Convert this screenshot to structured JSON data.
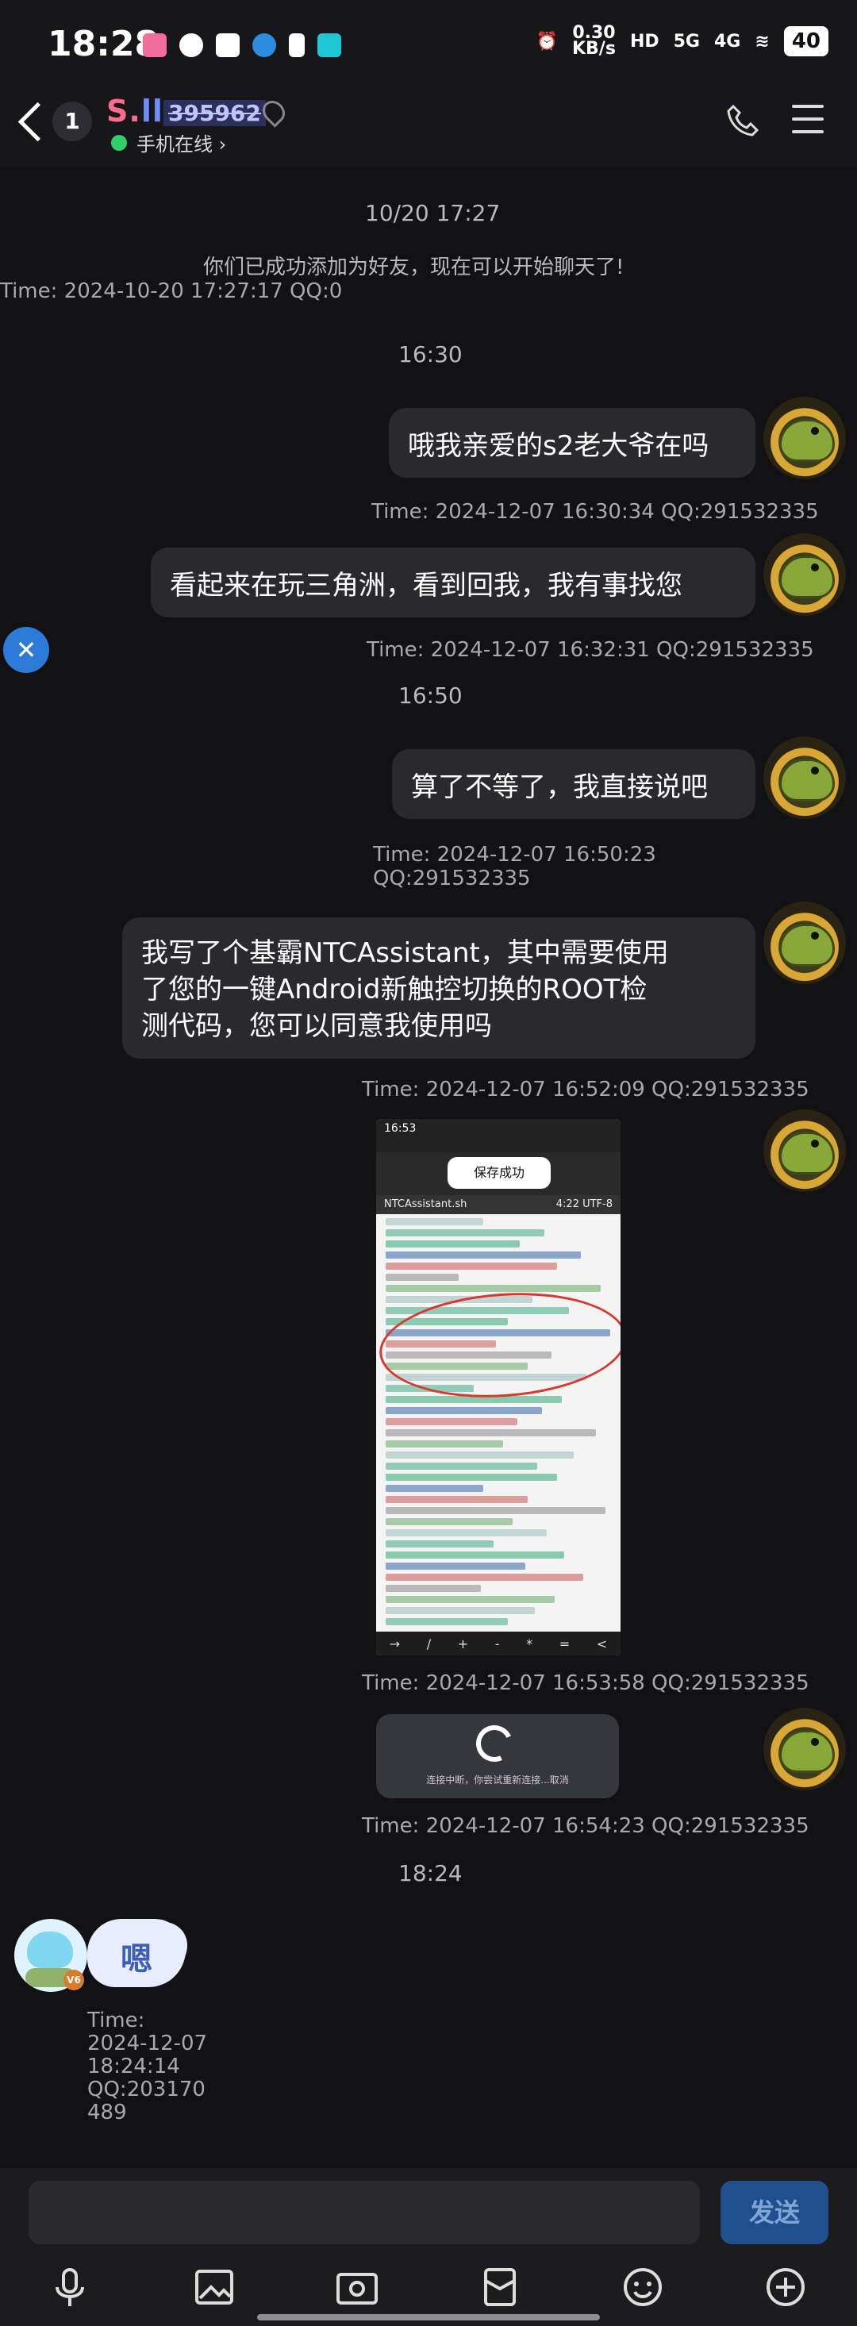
{
  "status_bar": {
    "time": "18:28",
    "net_speed": "0.30\nKB/s",
    "net_speed_top": "0.30",
    "net_speed_bottom": "KB/s",
    "signal_labels": [
      "HD",
      "5G",
      "4G"
    ],
    "battery": "40"
  },
  "header": {
    "unread_count": "1",
    "contact_name_prefix": "S.",
    "contact_name_suffix": "ll",
    "contact_id": "395962",
    "online_status": "手机在线 ›"
  },
  "messages": {
    "d1": "10/20 17:27",
    "sys1": "你们已成功添加为好友，现在可以开始聊天了!",
    "meta1": "Time: 2024-10-20 17:27:17 QQ:0",
    "d2": "16:30",
    "b1": "哦我亲爱的s2老大爷在吗",
    "meta2": "Time: 2024-12-07 16:30:34 QQ:291532335",
    "b2": "看起来在玩三角洲，看到回我，我有事找您",
    "meta3": "Time: 2024-12-07 16:32:31 QQ:291532335",
    "d3": "16:50",
    "b3": "算了不等了，我直接说吧",
    "meta4_line1": "Time: 2024-12-07 16:50:23",
    "meta4_line2": "QQ:291532335",
    "b4_line1": "我写了个基霸NTCAssistant，其中需要使用",
    "b4_line2": "了您的一键Android新触控切换的ROOT检",
    "b4_line3": "测代码，您可以同意我使用吗",
    "meta5": "Time: 2024-12-07 16:52:09 QQ:291532335",
    "img_time": "16:53",
    "img_saved": "保存成功",
    "img_file": "NTCAssistant.sh",
    "img_pos": "4:22 UTF-8",
    "meta6": "Time: 2024-12-07 16:53:58 QQ:291532335",
    "loading_text": "连接中断，你尝试重新连接...取消",
    "meta7": "Time: 2024-12-07 16:54:23 QQ:291532335",
    "d4": "18:24",
    "sticker_text": "嗯",
    "vip": "V6",
    "meta8_l1": "Time:",
    "meta8_l2": "2024-12-07",
    "meta8_l3": "18:24:14",
    "meta8_l4": "QQ:203170",
    "meta8_l5": "489"
  },
  "input": {
    "send_label": "发送"
  },
  "icons": [
    "mic-icon",
    "image-icon",
    "camera-icon",
    "red-packet-icon",
    "emoji-icon",
    "plus-icon"
  ],
  "colors": {
    "background": "#121214",
    "bubble": "#2a2a2e",
    "send": "#1f4f8c",
    "online": "#2fd06a"
  }
}
